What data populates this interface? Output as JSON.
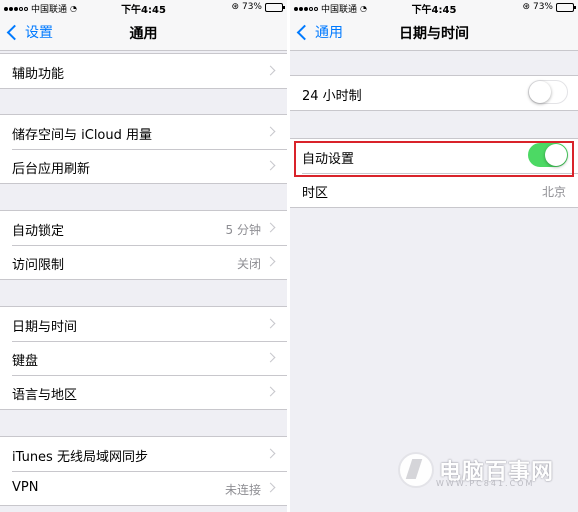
{
  "left_phone": {
    "status": {
      "carrier": "中国联通",
      "time": "下午4:45",
      "battery": "73%",
      "battery_level": 0.73
    },
    "nav": {
      "back": "设置",
      "title": "通用"
    },
    "groups": [
      [
        {
          "label": "辅助功能",
          "value": ""
        }
      ],
      [
        {
          "label": "储存空间与 iCloud 用量",
          "value": ""
        },
        {
          "label": "后台应用刷新",
          "value": ""
        }
      ],
      [
        {
          "label": "自动锁定",
          "value": "5 分钟"
        },
        {
          "label": "访问限制",
          "value": "关闭"
        }
      ],
      [
        {
          "label": "日期与时间",
          "value": ""
        },
        {
          "label": "键盘",
          "value": ""
        },
        {
          "label": "语言与地区",
          "value": ""
        }
      ],
      [
        {
          "label": "iTunes 无线局域网同步",
          "value": ""
        },
        {
          "label": "VPN",
          "value": "未连接"
        }
      ]
    ]
  },
  "right_phone": {
    "status": {
      "carrier": "中国联通",
      "time": "下午4:45",
      "battery": "73%",
      "battery_level": 0.73
    },
    "nav": {
      "back": "通用",
      "title": "日期与时间"
    },
    "rows": {
      "h24": {
        "label": "24 小时制",
        "on": false
      },
      "auto": {
        "label": "自动设置",
        "on": true
      },
      "timezone": {
        "label": "时区",
        "value": "北京"
      }
    }
  },
  "colors": {
    "accent": "#007aff",
    "toggle_on": "#4cd964",
    "highlight": "#d9232a"
  },
  "watermark": {
    "text": "电脑百事网",
    "sub": "WWW.PC841.COM"
  }
}
